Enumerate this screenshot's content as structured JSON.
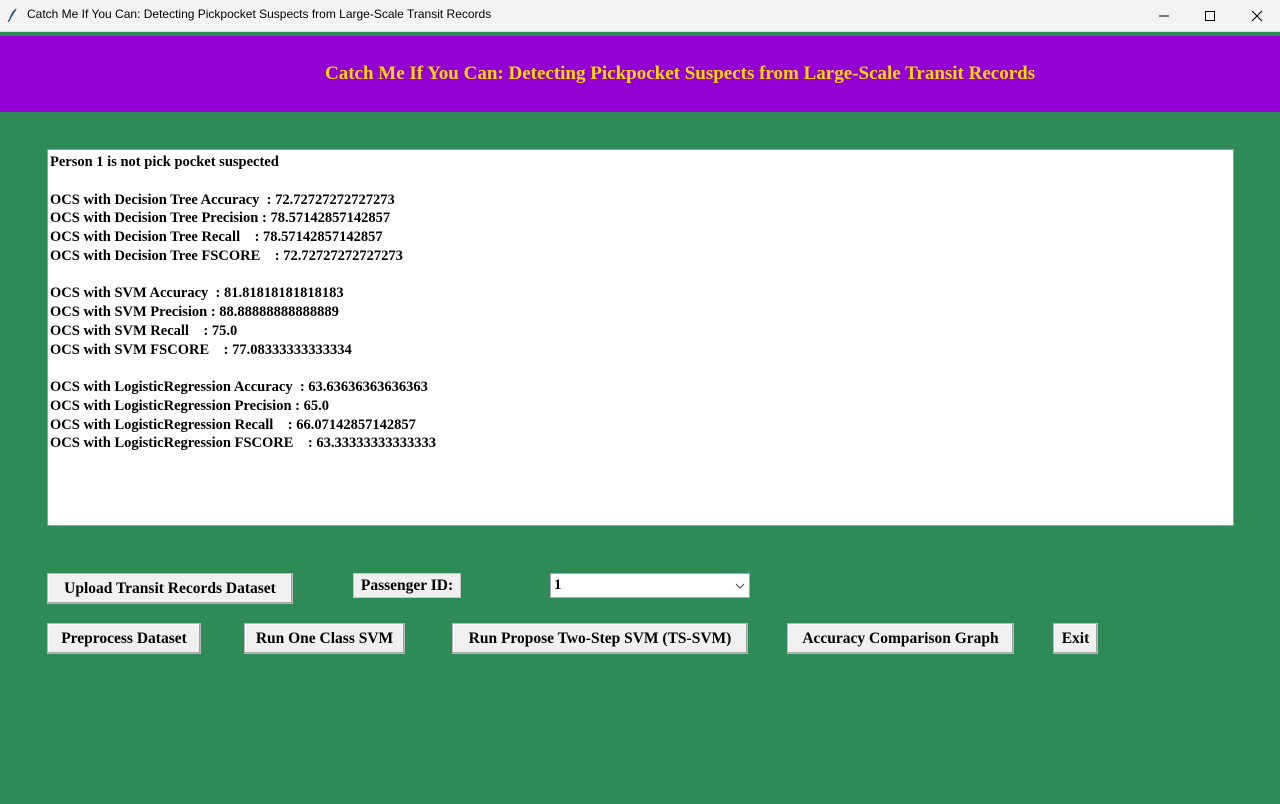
{
  "window": {
    "title": "Catch Me If You Can: Detecting Pickpocket Suspects from Large-Scale Transit Records"
  },
  "header": {
    "title": "Catch Me If You Can: Detecting Pickpocket Suspects from Large-Scale Transit Records"
  },
  "output": {
    "lines": [
      "Person 1 is not pick pocket suspected",
      "",
      "OCS with Decision Tree Accuracy  : 72.72727272727273",
      "OCS with Decision Tree Precision : 78.57142857142857",
      "OCS with Decision Tree Recall    : 78.57142857142857",
      "OCS with Decision Tree FSCORE    : 72.72727272727273",
      "",
      "OCS with SVM Accuracy  : 81.81818181818183",
      "OCS with SVM Precision : 88.88888888888889",
      "OCS with SVM Recall    : 75.0",
      "OCS with SVM FSCORE    : 77.08333333333334",
      "",
      "OCS with LogisticRegression Accuracy  : 63.63636363636363",
      "OCS with LogisticRegression Precision : 65.0",
      "OCS with LogisticRegression Recall    : 66.07142857142857",
      "OCS with LogisticRegression FSCORE    : 63.33333333333333"
    ]
  },
  "controls": {
    "upload_button": "Upload Transit Records Dataset",
    "passenger_label": "Passenger ID:",
    "passenger_value": "1",
    "preprocess_button": "Preprocess Dataset",
    "one_class_button": "Run One Class SVM",
    "ts_svm_button": "Run Propose Two-Step SVM (TS-SVM)",
    "comparison_button": "Accuracy Comparison Graph",
    "exit_button": "Exit"
  },
  "colors": {
    "background": "#2e8b57",
    "header_bg": "#9400d3",
    "header_text": "#ffd700"
  },
  "icons": {
    "app": "feather-icon",
    "minimize": "minimize-icon",
    "maximize": "maximize-icon",
    "close": "close-icon",
    "dropdown": "chevron-down-icon"
  }
}
